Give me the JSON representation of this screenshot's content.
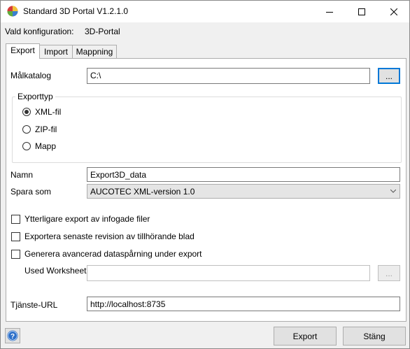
{
  "window": {
    "title": "Standard 3D Portal V1.2.1.0"
  },
  "config": {
    "label": "Vald konfiguration:",
    "value": "3D-Portal"
  },
  "tabs": [
    {
      "label": "Export"
    },
    {
      "label": "Import"
    },
    {
      "label": "Mappning"
    }
  ],
  "export": {
    "target_label": "Målkatalog",
    "target_value": "C:\\",
    "browse_label": "...",
    "export_type": {
      "label": "Exporttyp",
      "options": [
        {
          "label": "XML-fil",
          "checked": true
        },
        {
          "label": "ZIP-fil",
          "checked": false
        },
        {
          "label": "Mapp",
          "checked": false
        }
      ]
    },
    "name_label": "Namn",
    "name_value": "Export3D_data",
    "save_as_label": "Spara som",
    "save_as_value": "AUCOTEC XML-version 1.0",
    "options": [
      {
        "label": "Ytterligare export av infogade filer",
        "checked": false
      },
      {
        "label": "Exportera senaste revision av tillhörande blad",
        "checked": false
      },
      {
        "label": "Generera avancerad dataspårning under export",
        "checked": false
      }
    ],
    "worksheet_label": "Used Worksheet",
    "worksheet_value": "",
    "worksheet_browse_label": "...",
    "service_url_label": "Tjänste-URL",
    "service_url_value": "http://localhost:8735"
  },
  "footer": {
    "export_button": "Export",
    "close_button": "Stäng"
  }
}
